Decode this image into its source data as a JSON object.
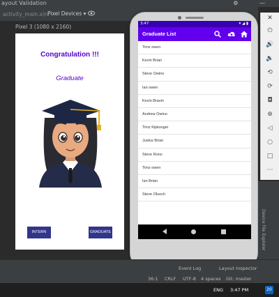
{
  "ide": {
    "window_title": "ayout Validation",
    "file_tab": "activity_main.xml",
    "devices_label": "Pixel Devices",
    "device_label": "Pixel 3 (1080 x 2160)"
  },
  "preview": {
    "congrats": "Congratulation !!!",
    "graduate": "Graduate",
    "intern_button": "INTERN",
    "graduate_button": "GRADUATE"
  },
  "emulator": {
    "status_time": "3:47",
    "app_title": "Graduate List",
    "list": [
      "Timz owen",
      "Kevin Brian",
      "Steve Owino",
      "Ian owen",
      "Kevin Bravin",
      "Andrew Owino",
      "Timz Kipkosgei",
      "Justus Brian",
      "Steve Rono",
      "Timz owen",
      "Ian Brian",
      "Steve Oluoch"
    ]
  },
  "side_tools": {
    "vertical_label": "Device File Explorer"
  },
  "bottom": {
    "event_log": "Event Log",
    "layout_inspector": "Layout Inspector",
    "cursor": "36:1",
    "line_sep": "CRLF",
    "encoding": "UTF-8",
    "indent": "4 spaces",
    "git": "Git: master"
  },
  "taskbar": {
    "lang": "ENG",
    "time": "3:47 PM",
    "notif": "20"
  },
  "colors": {
    "accent": "#6200ee",
    "status": "#3700b3",
    "text_purple": "#5500cc",
    "button_blue": "#31358b"
  }
}
